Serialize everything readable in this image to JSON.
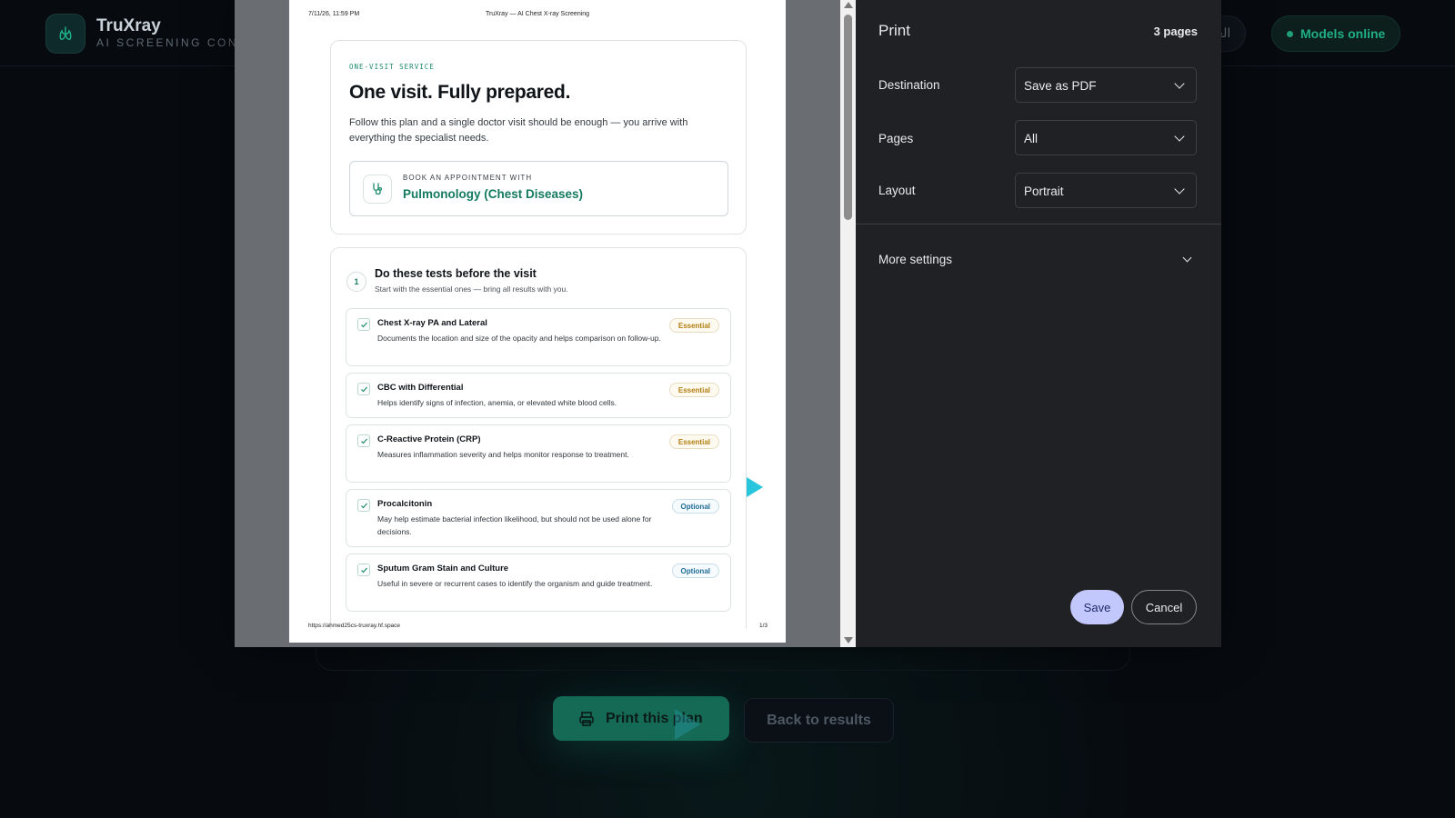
{
  "app": {
    "brand_name": "TruXray",
    "brand_tagline": "AI SCREENING CONSOLE",
    "language_button": "العربية",
    "status_label": "Models online",
    "print_plan_button": "Print this plan",
    "back_button": "Back to results"
  },
  "print_dialog": {
    "title": "Print",
    "page_count": "3 pages",
    "destination": {
      "label": "Destination",
      "value": "Save as PDF"
    },
    "pages": {
      "label": "Pages",
      "value": "All"
    },
    "layout": {
      "label": "Layout",
      "value": "Portrait"
    },
    "more_settings": "More settings",
    "save_button": "Save",
    "cancel_button": "Cancel"
  },
  "preview_page": {
    "header_date": "7/11/26, 11:59 PM",
    "header_title": "TruXray — AI Chest X-ray Screening",
    "footer_url": "https://ahmed25cs-truxray.hf.space",
    "footer_page": "1/3",
    "eyebrow": "ONE-VISIT SERVICE",
    "heading": "One visit. Fully prepared.",
    "intro": "Follow this plan and a single doctor visit should be enough — you arrive with everything the specialist needs.",
    "appointment_label": "BOOK AN APPOINTMENT WITH",
    "appointment_value": "Pulmonology (Chest Diseases)",
    "step": {
      "number": "1",
      "title": "Do these tests before the visit",
      "subtitle": "Start with the essential ones — bring all results with you."
    },
    "tests": [
      {
        "name": "Chest X-ray PA and Lateral",
        "description": "Documents the location and size of the opacity and helps comparison on follow-up.",
        "badge": "Essential"
      },
      {
        "name": "CBC with Differential",
        "description": "Helps identify signs of infection, anemia, or elevated white blood cells.",
        "badge": "Essential"
      },
      {
        "name": "C-Reactive Protein (CRP)",
        "description": "Measures inflammation severity and helps monitor response to treatment.",
        "badge": "Essential"
      },
      {
        "name": "Procalcitonin",
        "description": "May help estimate bacterial infection likelihood, but should not be used alone for decisions.",
        "badge": "Optional"
      },
      {
        "name": "Sputum Gram Stain and Culture",
        "description": "Useful in severe or recurrent cases to identify the organism and guide treatment.",
        "badge": "Optional"
      }
    ]
  },
  "colors": {
    "accent": "#1fae85",
    "essential": "#b07d10",
    "optional": "#1f6c93",
    "save_button": "#c2c8fb"
  }
}
